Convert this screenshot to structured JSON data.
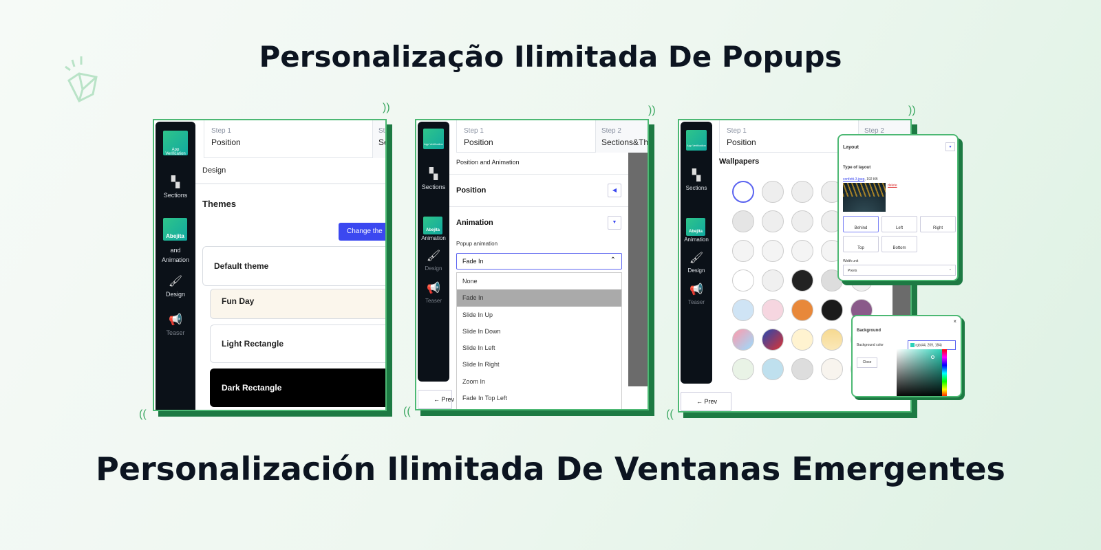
{
  "headline_pt": "Personalização Ilimitada De Popups",
  "headline_es": "Personalización Ilimitada De Ventanas Emergentes",
  "logo_text": "App Verification",
  "logo_badge": "Abejita",
  "colors": {
    "accent": "#3b48f0",
    "frame": "#4cb873",
    "frame_shadow": "#1d7a43",
    "sidebar": "#0b1118"
  },
  "sidebar": {
    "sections": "Sections",
    "position_animation_a": "and",
    "position_animation_b": "Animation",
    "animation": "Animation",
    "design": "Design",
    "teaser": "Teaser",
    "teaser_badge": "Teaser"
  },
  "panel1": {
    "step1_label": "Step 1",
    "step1_title": "Position",
    "step2_label": "St",
    "step2_title": "Se",
    "section": "Design",
    "heading": "Themes",
    "change_button": "Change the",
    "themes": [
      "Default theme",
      "Fun Day",
      "Light Rectangle",
      "Dark Rectangle"
    ]
  },
  "panel2": {
    "step1_label": "Step 1",
    "step1_title": "Position",
    "step2_label": "Step 2",
    "step2_title": "Sections&Them",
    "section": "Position and Animation",
    "position": "Position",
    "animation": "Animation",
    "field_label": "Popup animation",
    "selected": "Fade In",
    "options": [
      "None",
      "Fade In",
      "Slide In Up",
      "Slide In Down",
      "Slide In Left",
      "Slide In Right",
      "Zoom In",
      "Fade In Top Left"
    ],
    "prev": "← Prev"
  },
  "panel3": {
    "step1_label": "Step 1",
    "step1_title": "Position",
    "step2_label": "Step 2",
    "heading": "Wallpapers",
    "prev": "← Prev",
    "layout_popup": {
      "title": "Layout",
      "type_label": "Type of layout",
      "file_link": "confetti-3.jpeg",
      "file_size": ", 192 KB",
      "delete": "delete",
      "options": [
        "Behind",
        "Left",
        "Right",
        "Top",
        "Bottom"
      ],
      "selected": "Behind",
      "width_label": "Width unit",
      "width_value": "Pixels"
    },
    "bg_popup": {
      "title": "Background",
      "color_label": "Background color",
      "color_value": "rgb(44, 209, 184)",
      "close": "Close",
      "close_x": "×"
    }
  }
}
